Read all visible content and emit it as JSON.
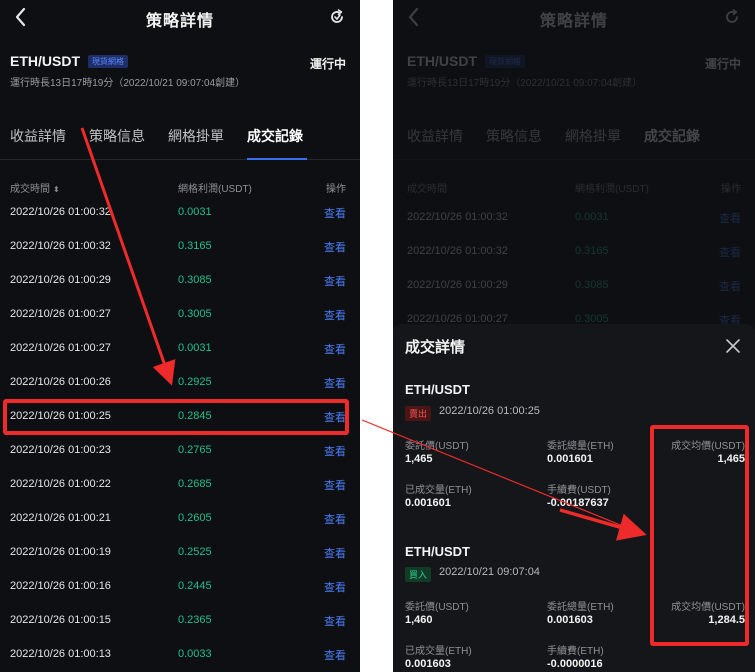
{
  "header": {
    "title": "策略詳情"
  },
  "strategy": {
    "pair": "ETH/USDT",
    "badge": "現貨網格",
    "status": "運行中",
    "runtime": "運行時長13日17時19分（2022/10/21 09:07:04創建）"
  },
  "tabs": [
    {
      "label": "收益詳情"
    },
    {
      "label": "策略信息"
    },
    {
      "label": "網格掛單"
    },
    {
      "label": "成交記錄"
    }
  ],
  "table": {
    "headers": {
      "time": "成交時間",
      "profit": "網格利潤(USDT)",
      "action": "操作"
    },
    "view_label": "查看",
    "rows": [
      {
        "time": "2022/10/26 01:00:32",
        "profit": "0.0031"
      },
      {
        "time": "2022/10/26 01:00:32",
        "profit": "0.3165"
      },
      {
        "time": "2022/10/26 01:00:29",
        "profit": "0.3085"
      },
      {
        "time": "2022/10/26 01:00:27",
        "profit": "0.3005"
      },
      {
        "time": "2022/10/26 01:00:27",
        "profit": "0.0031"
      },
      {
        "time": "2022/10/26 01:00:26",
        "profit": "0.2925"
      },
      {
        "time": "2022/10/26 01:00:25",
        "profit": "0.2845"
      },
      {
        "time": "2022/10/26 01:00:23",
        "profit": "0.2765"
      },
      {
        "time": "2022/10/26 01:00:22",
        "profit": "0.2685"
      },
      {
        "time": "2022/10/26 01:00:21",
        "profit": "0.2605"
      },
      {
        "time": "2022/10/26 01:00:19",
        "profit": "0.2525"
      },
      {
        "time": "2022/10/26 01:00:16",
        "profit": "0.2445"
      },
      {
        "time": "2022/10/26 01:00:15",
        "profit": "0.2365"
      },
      {
        "time": "2022/10/26 01:00:13",
        "profit": "0.0033"
      }
    ]
  },
  "detail": {
    "title": "成交詳情",
    "trades": [
      {
        "pair": "ETH/USDT",
        "side": "賣出",
        "date": "2022/10/26 01:00:25",
        "order_price_label": "委託價(USDT)",
        "order_price": "1,465",
        "order_amount_label": "委託總量(ETH)",
        "order_amount": "0.001601",
        "avg_price_label": "成交均價(USDT)",
        "avg_price": "1,465",
        "filled_label": "已成交量(ETH)",
        "filled": "0.001601",
        "fee_label": "手續費(USDT)",
        "fee": "-0.00187637"
      },
      {
        "pair": "ETH/USDT",
        "side": "買入",
        "date": "2022/10/21 09:07:04",
        "order_price_label": "委託價(USDT)",
        "order_price": "1,460",
        "order_amount_label": "委託總量(ETH)",
        "order_amount": "0.001603",
        "avg_price_label": "成交均價(USDT)",
        "avg_price": "1,284.5",
        "filled_label": "已成交量(ETH)",
        "filled": "0.001603",
        "fee_label": "手續費(ETH)",
        "fee": "-0.0000016"
      }
    ]
  },
  "colors": {
    "profit": "#23c08a",
    "accent": "#3a6df0",
    "annotation": "#ef2a2a"
  }
}
